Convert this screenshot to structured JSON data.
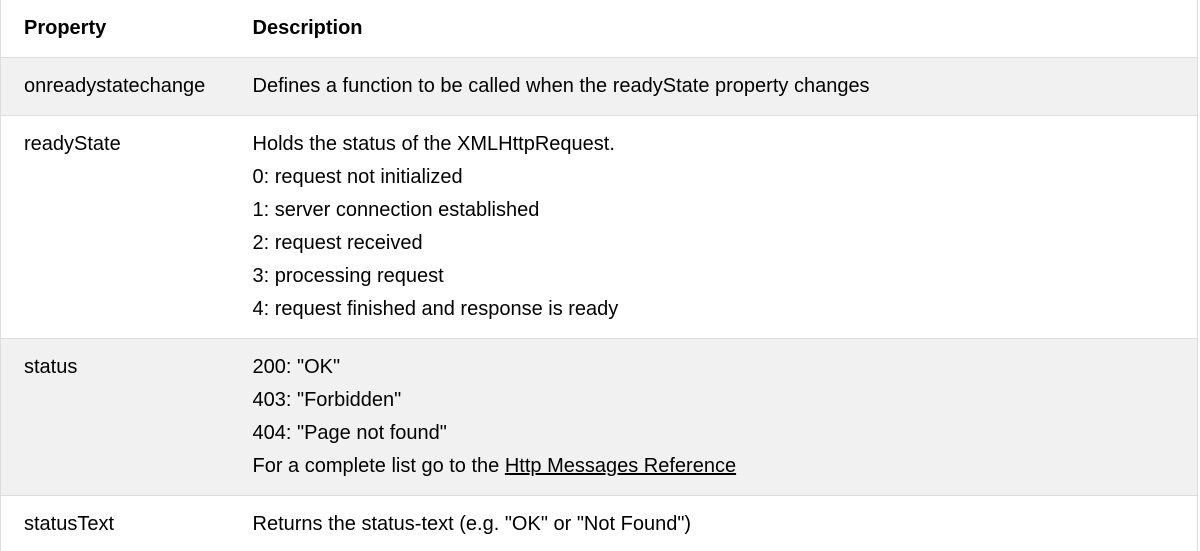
{
  "table": {
    "headers": {
      "property": "Property",
      "description": "Description"
    },
    "rows": [
      {
        "property": "onreadystatechange",
        "lines": [
          "Defines a function to be called when the readyState property changes"
        ]
      },
      {
        "property": "readyState",
        "lines": [
          "Holds the status of the XMLHttpRequest.",
          "0: request not initialized",
          "1: server connection established",
          "2: request received",
          "3: processing request",
          "4: request finished and response is ready"
        ]
      },
      {
        "property": "status",
        "lines": [
          "200: \"OK\"",
          "403: \"Forbidden\"",
          "404: \"Page not found\""
        ],
        "link_prefix": "For a complete list go to the ",
        "link_text": "Http Messages Reference"
      },
      {
        "property": "statusText",
        "lines": [
          "Returns the status-text (e.g. \"OK\" or \"Not Found\")"
        ]
      }
    ]
  },
  "colors": {
    "alt_row_bg": "#f1f1f1",
    "border": "#dddddd",
    "text": "#000000"
  }
}
